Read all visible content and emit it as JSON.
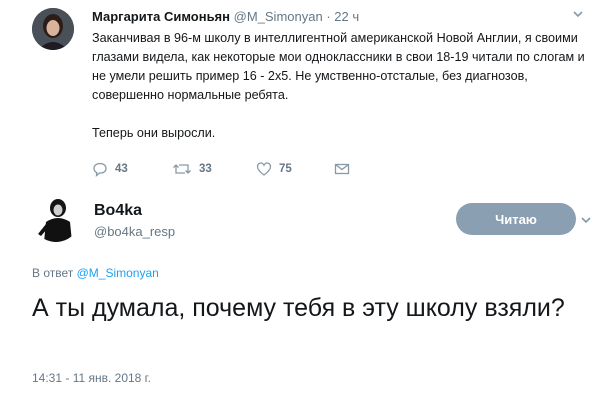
{
  "original_tweet": {
    "author_name": "Маргарита Симоньян",
    "author_handle": "@M_Simonyan",
    "separator": "·",
    "time": "22 ч",
    "text_p1": "Заканчивая в 96-м школу в интеллигентной американской Новой Англии, я своими глазами видела, как некоторые мои одноклассники в свои 18-19 читали по слогам и не умели решить пример 16 - 2х5. Не умственно-отсталые, без диагнозов, совершенно нормальные ребята.",
    "text_p2": "Теперь они выросли.",
    "actions": {
      "replies": "43",
      "retweets": "33",
      "likes": "75"
    }
  },
  "reply_tweet": {
    "author_name": "Bo4ka",
    "author_handle": "@bo4ka_resp",
    "follow_label": "Читаю",
    "replying_prefix": "В ответ",
    "replying_to": "@M_Simonyan",
    "text": "А ты думала, почему тебя в эту школу взяли?",
    "timestamp": "14:31 - 11 янв. 2018 г."
  },
  "colors": {
    "text": "#14171a",
    "muted": "#657786",
    "link": "#1da1f2",
    "follow_button": "#8a9fb2"
  },
  "icons": [
    "avatar-photo",
    "chevron-down-icon",
    "reply-icon",
    "retweet-icon",
    "heart-icon",
    "message-icon"
  ]
}
